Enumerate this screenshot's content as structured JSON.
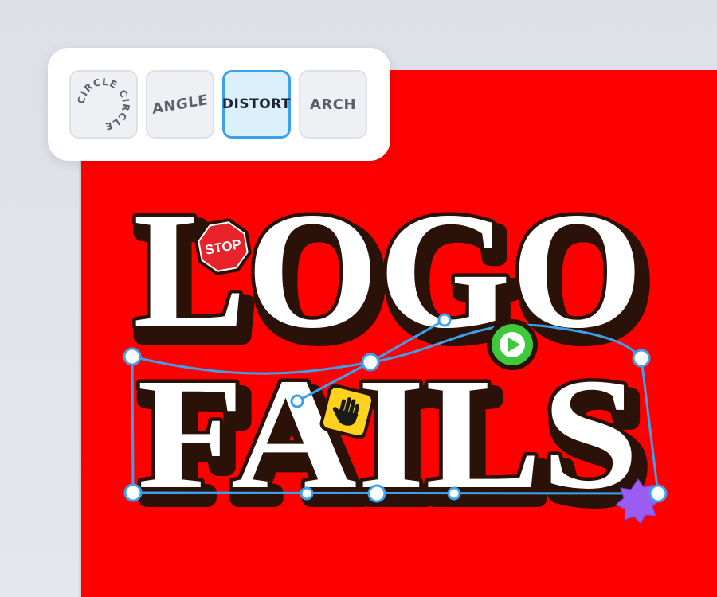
{
  "toolbar": {
    "styles": [
      {
        "label": "CIRCLE CIRCLE",
        "icon": "circle-text-icon"
      },
      {
        "label": "ANGLE",
        "icon": "angle-text-icon"
      },
      {
        "label": "DISTORT",
        "icon": "distort-text-icon",
        "selected": true
      },
      {
        "label": "ARCH",
        "icon": "arch-text-icon"
      }
    ]
  },
  "artwork": {
    "line1": "LOGO",
    "line2": "FAILS",
    "stickers": {
      "stop": "STOP",
      "hand": "hand-icon",
      "play": "play-icon",
      "starburst": "starburst-icon"
    },
    "colors": {
      "background": "#ff0000",
      "text_fill": "#ffffff",
      "text_shadow": "#2a1208",
      "handles": "#3ba1ee",
      "stop_sign": "#e8232a",
      "hand_sticker": "#ffd21f",
      "play_sticker": "#3ec93a",
      "starburst": "#9b5cf2"
    }
  }
}
